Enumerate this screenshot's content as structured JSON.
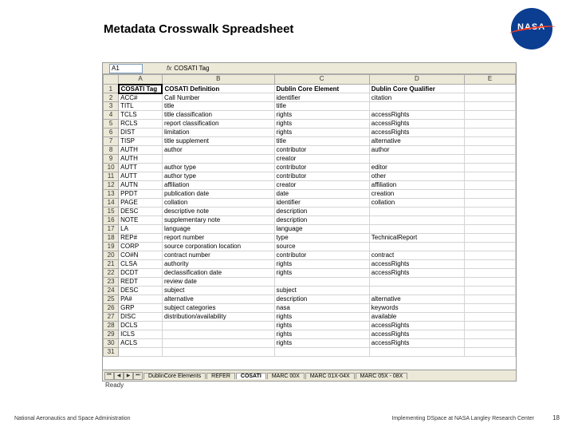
{
  "title": "Metadata Crosswalk Spreadsheet",
  "nasa": "NASA",
  "cellbar": {
    "name": "A1",
    "fx": "fx",
    "formula": "COSATI Tag"
  },
  "colhdrs": [
    "A",
    "B",
    "C",
    "D",
    "E"
  ],
  "rows": [
    {
      "n": "1",
      "a": "COSATI Tag",
      "b": "COSATI Definition",
      "c": "Dublin Core Element",
      "d": "Dublin Core Qualifier",
      "e": "",
      "hdr": true
    },
    {
      "n": "2",
      "a": "ACC#",
      "b": "Call Number",
      "c": "identifier",
      "d": "citation",
      "e": ""
    },
    {
      "n": "3",
      "a": "TITL",
      "b": "title",
      "c": "title",
      "d": "",
      "e": ""
    },
    {
      "n": "4",
      "a": "TCLS",
      "b": "title classification",
      "c": "rights",
      "d": "accessRights",
      "e": ""
    },
    {
      "n": "5",
      "a": "RCLS",
      "b": "report classification",
      "c": "rights",
      "d": "accessRights",
      "e": ""
    },
    {
      "n": "6",
      "a": "DIST",
      "b": "limitation",
      "c": "rights",
      "d": "accessRights",
      "e": ""
    },
    {
      "n": "7",
      "a": "TISP",
      "b": "title supplement",
      "c": "title",
      "d": "alternative",
      "e": ""
    },
    {
      "n": "8",
      "a": "AUTH",
      "b": "author",
      "c": "contributor",
      "d": "author",
      "e": ""
    },
    {
      "n": "9",
      "a": "AUTH",
      "b": "",
      "c": "creator",
      "d": "",
      "e": ""
    },
    {
      "n": "10",
      "a": "AUTT",
      "b": "author type",
      "c": "contributor",
      "d": "editor",
      "e": ""
    },
    {
      "n": "11",
      "a": "AUTT",
      "b": "author type",
      "c": "contributor",
      "d": "other",
      "e": ""
    },
    {
      "n": "12",
      "a": "AUTN",
      "b": "affiliation",
      "c": "creator",
      "d": "affiliation",
      "e": ""
    },
    {
      "n": "13",
      "a": "PPDT",
      "b": "publication date",
      "c": "date",
      "d": "creation",
      "e": ""
    },
    {
      "n": "14",
      "a": "PAGE",
      "b": "collation",
      "c": "identifier",
      "d": "collation",
      "e": ""
    },
    {
      "n": "15",
      "a": "DESC",
      "b": "descriptive note",
      "c": "description",
      "d": "",
      "e": ""
    },
    {
      "n": "16",
      "a": "NOTE",
      "b": "supplementary note",
      "c": "description",
      "d": "",
      "e": ""
    },
    {
      "n": "17",
      "a": "LA",
      "b": "language",
      "c": "language",
      "d": "",
      "e": ""
    },
    {
      "n": "18",
      "a": "REP#",
      "b": "report number",
      "c": "type",
      "d": "TechnicalReport",
      "e": ""
    },
    {
      "n": "19",
      "a": "CORP",
      "b": "source corporation location",
      "c": "source",
      "d": "",
      "e": ""
    },
    {
      "n": "20",
      "a": "CO#N",
      "b": "contract number",
      "c": "contributor",
      "d": "contract",
      "e": ""
    },
    {
      "n": "21",
      "a": "CLSA",
      "b": "authority",
      "c": "rights",
      "d": "accessRights",
      "e": ""
    },
    {
      "n": "22",
      "a": "DCDT",
      "b": "declassification date",
      "c": "rights",
      "d": "accessRights",
      "e": ""
    },
    {
      "n": "23",
      "a": "REDT",
      "b": "review date",
      "c": "",
      "d": "",
      "e": ""
    },
    {
      "n": "24",
      "a": "DESC",
      "b": "subject",
      "c": "subject",
      "d": "",
      "e": ""
    },
    {
      "n": "25",
      "a": "PA#",
      "b": "alternative",
      "c": "description",
      "d": "alternative",
      "e": ""
    },
    {
      "n": "26",
      "a": "GRP",
      "b": "subject categories",
      "c": "nasa",
      "d": "keywords",
      "e": ""
    },
    {
      "n": "27",
      "a": "DISC",
      "b": "distribution/availability",
      "c": "rights",
      "d": "available",
      "e": ""
    },
    {
      "n": "28",
      "a": "DCLS",
      "b": "",
      "c": "rights",
      "d": "accessRights",
      "e": ""
    },
    {
      "n": "29",
      "a": "ICLS",
      "b": "",
      "c": "rights",
      "d": "accessRights",
      "e": ""
    },
    {
      "n": "30",
      "a": "ACLS",
      "b": "",
      "c": "rights",
      "d": "accessRights",
      "e": ""
    },
    {
      "n": "31",
      "a": "",
      "b": "",
      "c": "",
      "d": "",
      "e": ""
    }
  ],
  "tabs": [
    "DublinCore Elements",
    "REFER",
    "COSATI",
    "MARC 00X",
    "MARC 01X-04X",
    "MARC 05X - 08X"
  ],
  "active_tab": 2,
  "status": "Ready",
  "footer": {
    "left": "National Aeronautics and Space Administration",
    "right": "Implementing DSpace at NASA Langley Research Center",
    "page": "18"
  }
}
